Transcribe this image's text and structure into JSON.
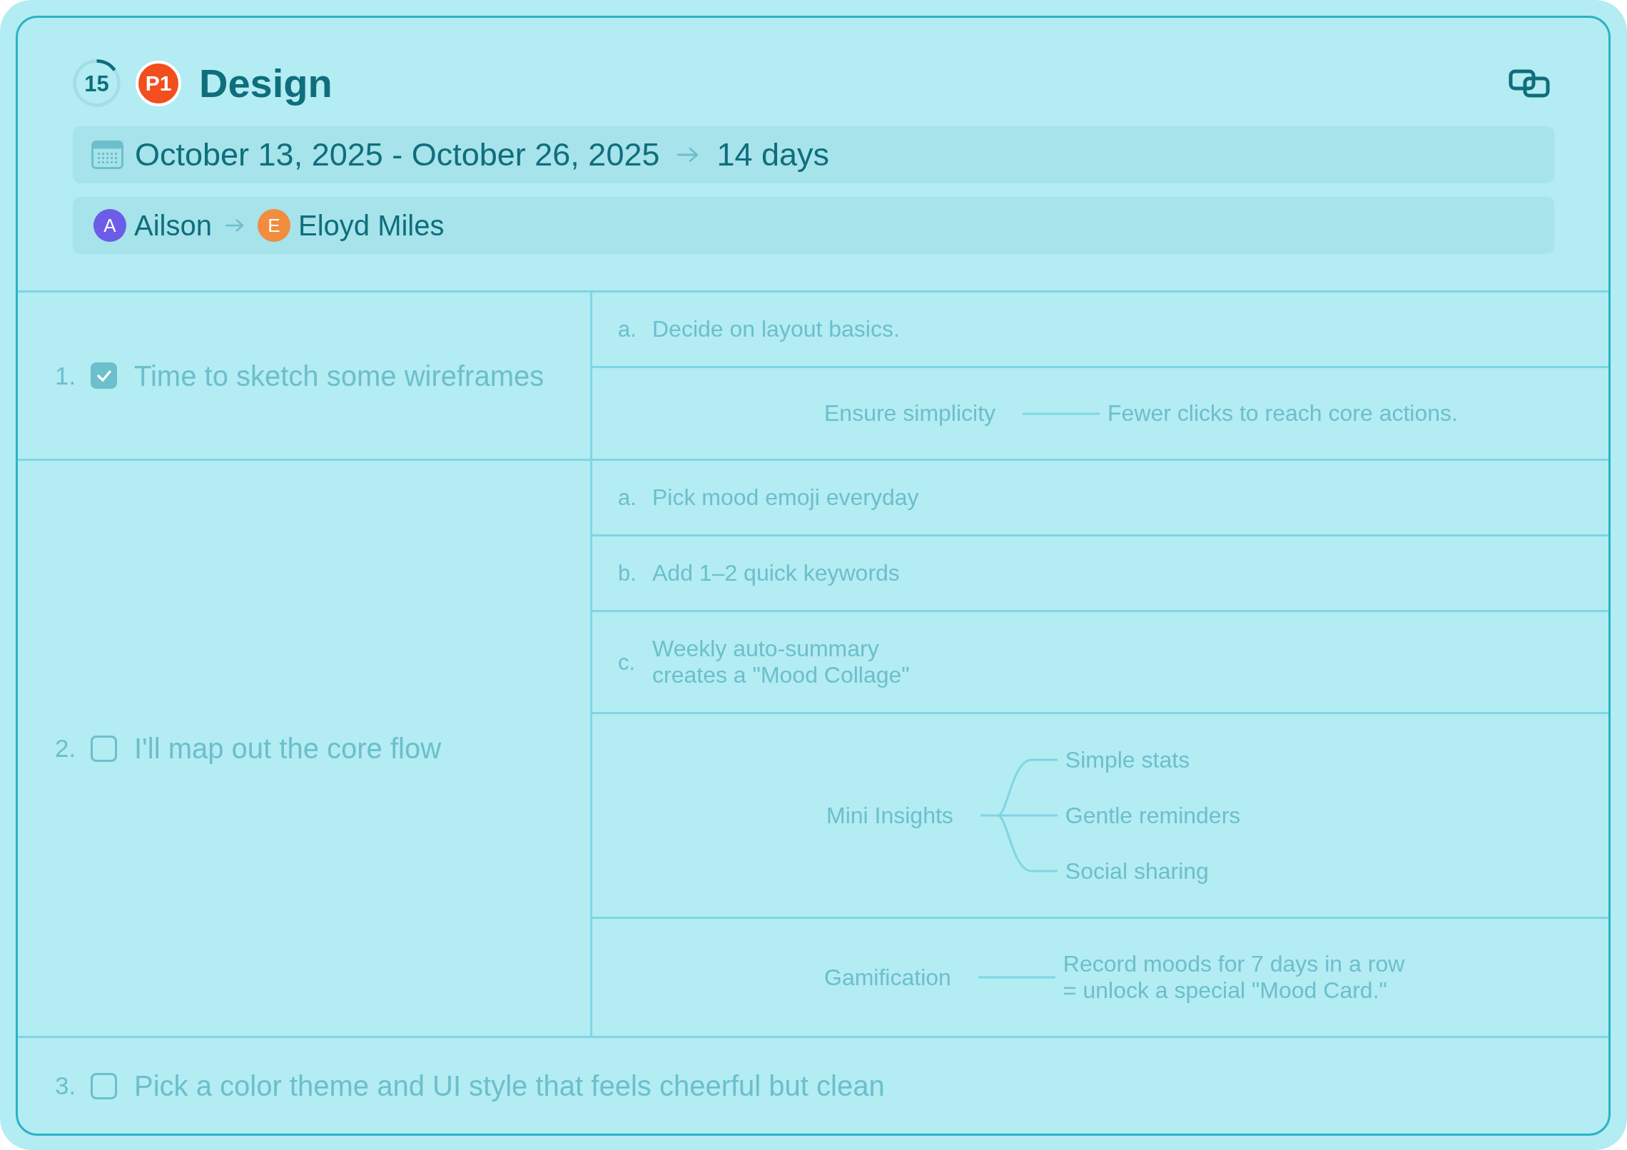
{
  "header": {
    "progress": {
      "label": "15",
      "level": 0.15
    },
    "priority": "P1",
    "title": "Design"
  },
  "schedule": {
    "dates": "October 13, 2025 - October 26, 2025",
    "duration": "14 days"
  },
  "assignees": [
    {
      "initial": "A",
      "name": "Ailson",
      "color": "#6c5ce7"
    },
    {
      "initial": "E",
      "name": "Eloyd Miles",
      "color": "#f28c3f"
    }
  ],
  "tasks": [
    {
      "number": "1.",
      "text": "Time to sketch some wireframes",
      "checked": true,
      "details": [
        {
          "kind": "step",
          "marker": "a.",
          "text": "Decide on layout basics."
        },
        {
          "kind": "link",
          "topic": "Ensure simplicity",
          "note": "Fewer clicks to reach core actions."
        }
      ]
    },
    {
      "number": "2.",
      "text": "I'll map out the core flow",
      "checked": false,
      "details": [
        {
          "kind": "step",
          "marker": "a.",
          "text": "Pick mood emoji everyday"
        },
        {
          "kind": "step",
          "marker": "b.",
          "text": "Add 1–2 quick keywords"
        },
        {
          "kind": "step",
          "marker": "c.",
          "text": "Weekly auto-summary\ncreates a \"Mood Collage\""
        },
        {
          "kind": "branch",
          "topic": "Mini Insights",
          "leaves": [
            "Simple stats",
            "Gentle reminders",
            "Social sharing"
          ]
        },
        {
          "kind": "link",
          "topic": "Gamification",
          "note": "Record moods for 7 days in a row\n= unlock a special \"Mood Card.\""
        }
      ]
    },
    {
      "number": "3.",
      "text": "Pick a color theme and UI style that feels cheerful but clean",
      "checked": false
    }
  ]
}
